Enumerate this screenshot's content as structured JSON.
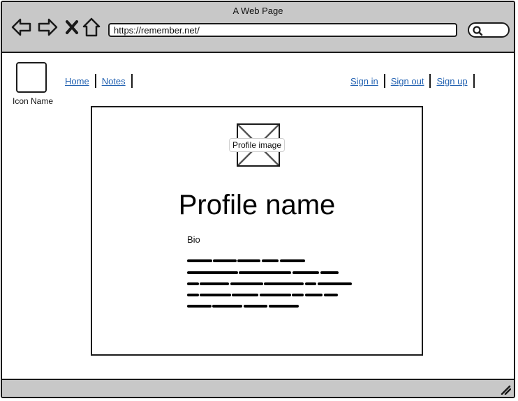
{
  "window": {
    "title": "A Web Page"
  },
  "toolbar": {
    "url": "https://remember.net/",
    "back_icon": "back-arrow-icon",
    "forward_icon": "forward-arrow-icon",
    "stop_icon": "close-icon",
    "home_icon": "home-icon",
    "search_icon": "search-icon"
  },
  "header": {
    "logo_caption": "Icon Name",
    "left_links": [
      "Home",
      "Notes"
    ],
    "right_links": [
      "Sign in",
      "Sign out",
      "Sign up"
    ]
  },
  "profile": {
    "image_label": "Profile image",
    "name": "Profile name",
    "bio_label": "Bio"
  },
  "colors": {
    "chrome": "#c8c8c8",
    "link": "#1f5fb0",
    "border": "#1a1a1a"
  }
}
